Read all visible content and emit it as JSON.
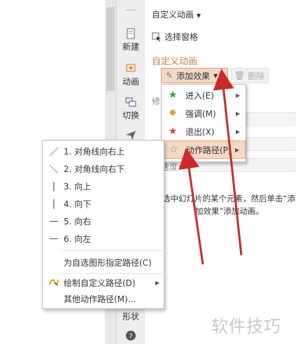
{
  "side_toolbar": {
    "new_label": "新建",
    "animation_label": "动画",
    "switch_label": "切换",
    "shape_label": "形状"
  },
  "task_pane": {
    "title": "自定义动画",
    "select_pane": "选择窗格",
    "section_title": "自定义动画",
    "add_effect": "添加效果",
    "delete": "删除",
    "modify_partial": "修",
    "speed_partial": "速度:",
    "hint_line1": "选中幻灯片的某个元素，然后单击“添",
    "hint_line2": "加效果”添加动画。"
  },
  "effect_menu": {
    "items": [
      {
        "label": "进入(E)",
        "icon": "green-star-icon"
      },
      {
        "label": "强调(M)",
        "icon": "yellow-star-icon"
      },
      {
        "label": "退出(X)",
        "icon": "red-star-icon"
      },
      {
        "label": "动作路径(P)",
        "icon": "outline-star-icon"
      }
    ]
  },
  "path_menu": {
    "items": [
      {
        "label": "1. 对角线向右上",
        "icon": "diagonal-up-right-icon"
      },
      {
        "label": "2. 对角线向右下",
        "icon": "diagonal-down-right-icon"
      },
      {
        "label": "3. 向上",
        "icon": "vertical-line-icon"
      },
      {
        "label": "4. 向下",
        "icon": "vertical-line-icon"
      },
      {
        "label": "5. 向右",
        "icon": "horizontal-line-icon"
      },
      {
        "label": "6. 向左",
        "icon": "horizontal-line-icon"
      },
      {
        "label": "为自选图形指定路径(C)"
      },
      {
        "label": "绘制自定义路径(D)",
        "icon": "draw-path-icon"
      },
      {
        "label": "其他动作路径(M)..."
      }
    ]
  },
  "watermark": "软件技巧",
  "colors": {
    "accent": "#c7813a",
    "highlight": "#f6d9c5",
    "arrow_red": "#cc2a2a"
  }
}
